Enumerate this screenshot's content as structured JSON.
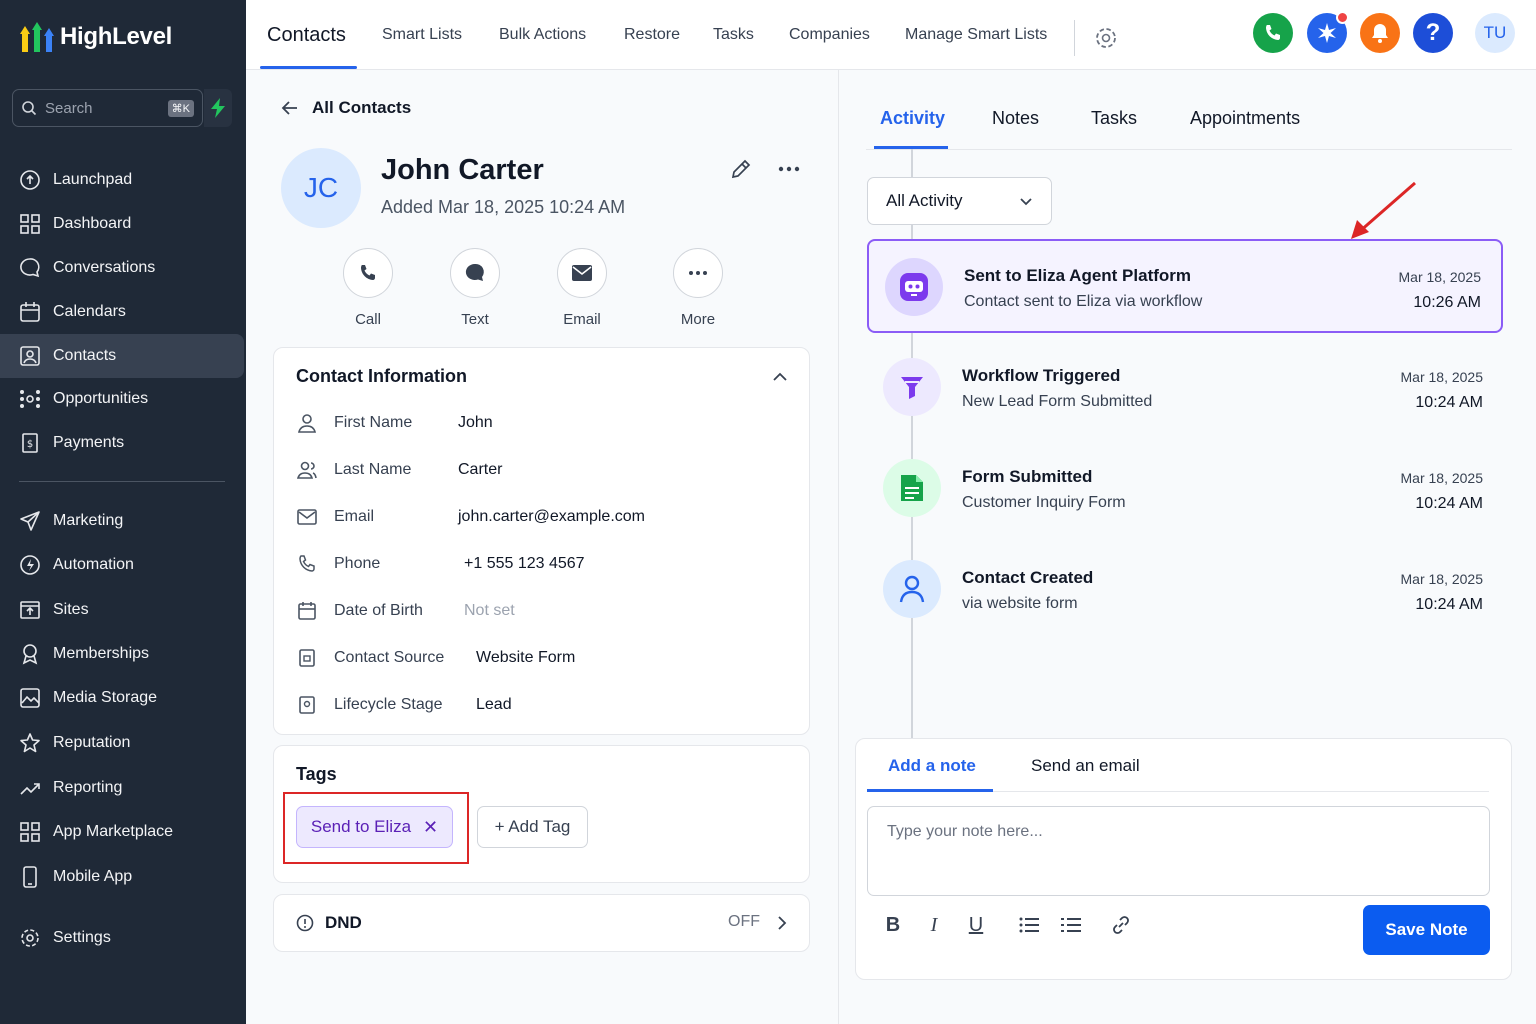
{
  "app": {
    "name": "HighLevel"
  },
  "sidebar": {
    "search_placeholder": "Search",
    "search_shortcut": "⌘K",
    "items": [
      {
        "label": "Launchpad",
        "icon": "launchpad-icon"
      },
      {
        "label": "Dashboard",
        "icon": "dashboard-icon"
      },
      {
        "label": "Conversations",
        "icon": "chat-bubble-icon"
      },
      {
        "label": "Calendars",
        "icon": "calendar-icon"
      },
      {
        "label": "Contacts",
        "icon": "contact-card-icon",
        "active": true
      },
      {
        "label": "Opportunities",
        "icon": "opportunities-icon"
      },
      {
        "label": "Payments",
        "icon": "payments-icon"
      },
      {
        "label": "Marketing",
        "icon": "send-icon"
      },
      {
        "label": "Automation",
        "icon": "automation-icon"
      },
      {
        "label": "Sites",
        "icon": "sites-icon"
      },
      {
        "label": "Memberships",
        "icon": "memberships-icon"
      },
      {
        "label": "Media Storage",
        "icon": "image-icon"
      },
      {
        "label": "Reputation",
        "icon": "star-icon"
      },
      {
        "label": "Reporting",
        "icon": "trend-icon"
      },
      {
        "label": "App Marketplace",
        "icon": "grid-icon"
      },
      {
        "label": "Mobile App",
        "icon": "mobile-icon"
      },
      {
        "label": "Settings",
        "icon": "gear-icon"
      }
    ]
  },
  "topbar": {
    "tabs": [
      "Contacts",
      "Smart Lists",
      "Bulk Actions",
      "Restore",
      "Tasks",
      "Companies",
      "Manage Smart Lists"
    ],
    "user_initials": "TU",
    "colors": {
      "phone": "#16a34a",
      "star": "#2563eb",
      "bell": "#f97316",
      "help": "#1d4ed8"
    }
  },
  "contact": {
    "back_label": "All Contacts",
    "initials": "JC",
    "name": "John Carter",
    "added": "Added Mar 18, 2025 10:24 AM",
    "actions": [
      "Call",
      "Text",
      "Email",
      "More"
    ],
    "info_title": "Contact Information",
    "fields": [
      {
        "label": "First Name",
        "value": "John"
      },
      {
        "label": "Last Name",
        "value": "Carter"
      },
      {
        "label": "Email",
        "value": "john.carter@example.com"
      },
      {
        "label": "Phone",
        "value": "+1 555 123 4567"
      },
      {
        "label": "Date of Birth",
        "value": "Not set"
      },
      {
        "label": "Contact Source",
        "value": "Website Form"
      },
      {
        "label": "Lifecycle Stage",
        "value": "Lead"
      }
    ],
    "tags_title": "Tags",
    "tags": [
      "Send to Eliza"
    ],
    "add_tag_label": "+ Add Tag",
    "dnd_label": "DND",
    "dnd_value": "OFF"
  },
  "activity": {
    "tabs": [
      "Activity",
      "Notes",
      "Tasks",
      "Appointments"
    ],
    "filter": "All Activity",
    "items": [
      {
        "title": "Sent to Eliza Agent Platform",
        "subtitle": "Contact sent to Eliza via workflow",
        "date": "Mar 18, 2025",
        "time": "10:26 AM",
        "icon": "robot-icon",
        "highlighted": true
      },
      {
        "title": "Workflow Triggered",
        "subtitle": "New Lead Form Submitted",
        "date": "Mar 18, 2025",
        "time": "10:24 AM",
        "icon": "funnel-icon"
      },
      {
        "title": "Form Submitted",
        "subtitle": "Customer Inquiry Form",
        "date": "Mar 18, 2025",
        "time": "10:24 AM",
        "icon": "form-document-icon"
      },
      {
        "title": "Contact Created",
        "subtitle": "via website form",
        "date": "Mar 18, 2025",
        "time": "10:24 AM",
        "icon": "user-icon"
      }
    ],
    "highlight_color": "#8b5cf6"
  },
  "note": {
    "tabs": [
      "Add a note",
      "Send an email"
    ],
    "placeholder": "Type your note here...",
    "save_label": "Save Note",
    "format_buttons": [
      "B",
      "I",
      "U"
    ]
  }
}
